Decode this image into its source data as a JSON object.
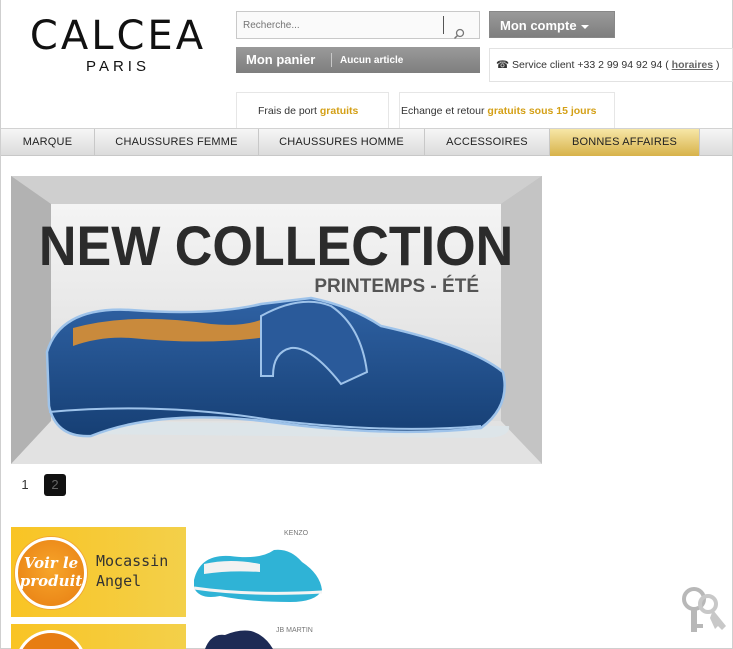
{
  "brand": {
    "name": "CALCEA",
    "city": "PARIS"
  },
  "search": {
    "placeholder": "Recherche..."
  },
  "cart": {
    "label": "Mon panier",
    "status": "Aucun article"
  },
  "account": {
    "label": "Mon compte"
  },
  "service": {
    "prefix": "☎ Service client +33 2 99 94 92 94 (",
    "link": "horaires",
    "suffix": ")"
  },
  "shipping": {
    "text": "Frais de port",
    "highlight": "gratuits"
  },
  "returns": {
    "text": "Echange et retour",
    "highlight": "gratuits sous 15 jours"
  },
  "nav": [
    {
      "label": "MARQUE"
    },
    {
      "label": "CHAUSSURES FEMME"
    },
    {
      "label": "CHAUSSURES HOMME"
    },
    {
      "label": "ACCESSOIRES"
    },
    {
      "label": "BONNES AFFAIRES"
    }
  ],
  "banner": {
    "title": "NEW COLLECTION",
    "subtitle": "PRINTEMPS - ÉTÉ"
  },
  "pager": {
    "pages": [
      "1",
      "2"
    ],
    "active": "2"
  },
  "promo": {
    "badge_line1": "Voir le",
    "badge_line2": "produit",
    "name_line1": "Mocassin",
    "name_line2": "Angel"
  },
  "products": [
    {
      "brand": "KENZO"
    },
    {
      "brand": "JB MARTIN"
    }
  ],
  "colors": {
    "accent_gold": "#d4a017",
    "promo_yellow": "#f9c424",
    "shoe_blue": "#1f4f8a",
    "shoe_turquoise": "#2fb3d6"
  },
  "icons": [
    "magnifier-icon",
    "phone-icon",
    "caret-down-icon",
    "keys-icon"
  ]
}
